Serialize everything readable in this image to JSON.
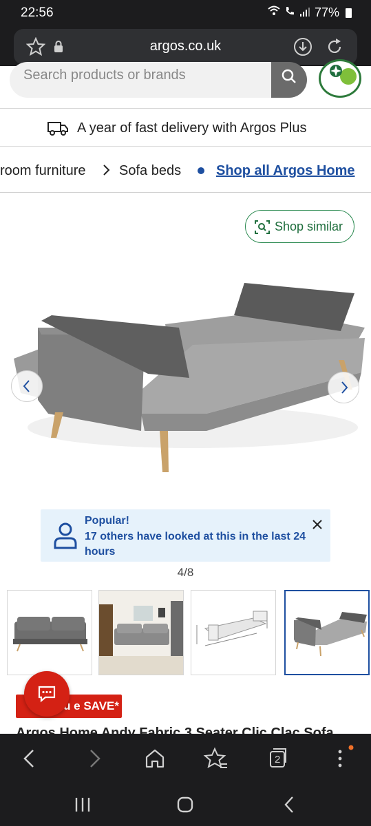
{
  "status_bar": {
    "time": "22:56",
    "battery": "77%"
  },
  "browser": {
    "url": "argos.co.uk",
    "tab_count": "2"
  },
  "search": {
    "placeholder": "Search products or brands"
  },
  "delivery_banner": {
    "text": "A year of fast delivery with Argos Plus"
  },
  "breadcrumb": {
    "items": [
      "room furniture",
      "Sofa beds"
    ],
    "link": "Shop all Argos Home"
  },
  "shop_similar": {
    "label": "Shop similar"
  },
  "popular": {
    "title": "Popular!",
    "body": "17 others have looked at this in the last 24 hours"
  },
  "gallery": {
    "counter": "4/8",
    "active_index": 3,
    "thumbnail_count": 4
  },
  "save_badge": {
    "label": "u        e SAVE*"
  },
  "product": {
    "title": "Argos Home Andy Fabric 3 Seater Clic Clac Sofa"
  },
  "colors": {
    "link_blue": "#1e4fa0",
    "argos_red": "#d42114",
    "accent_green": "#2d8b52"
  }
}
